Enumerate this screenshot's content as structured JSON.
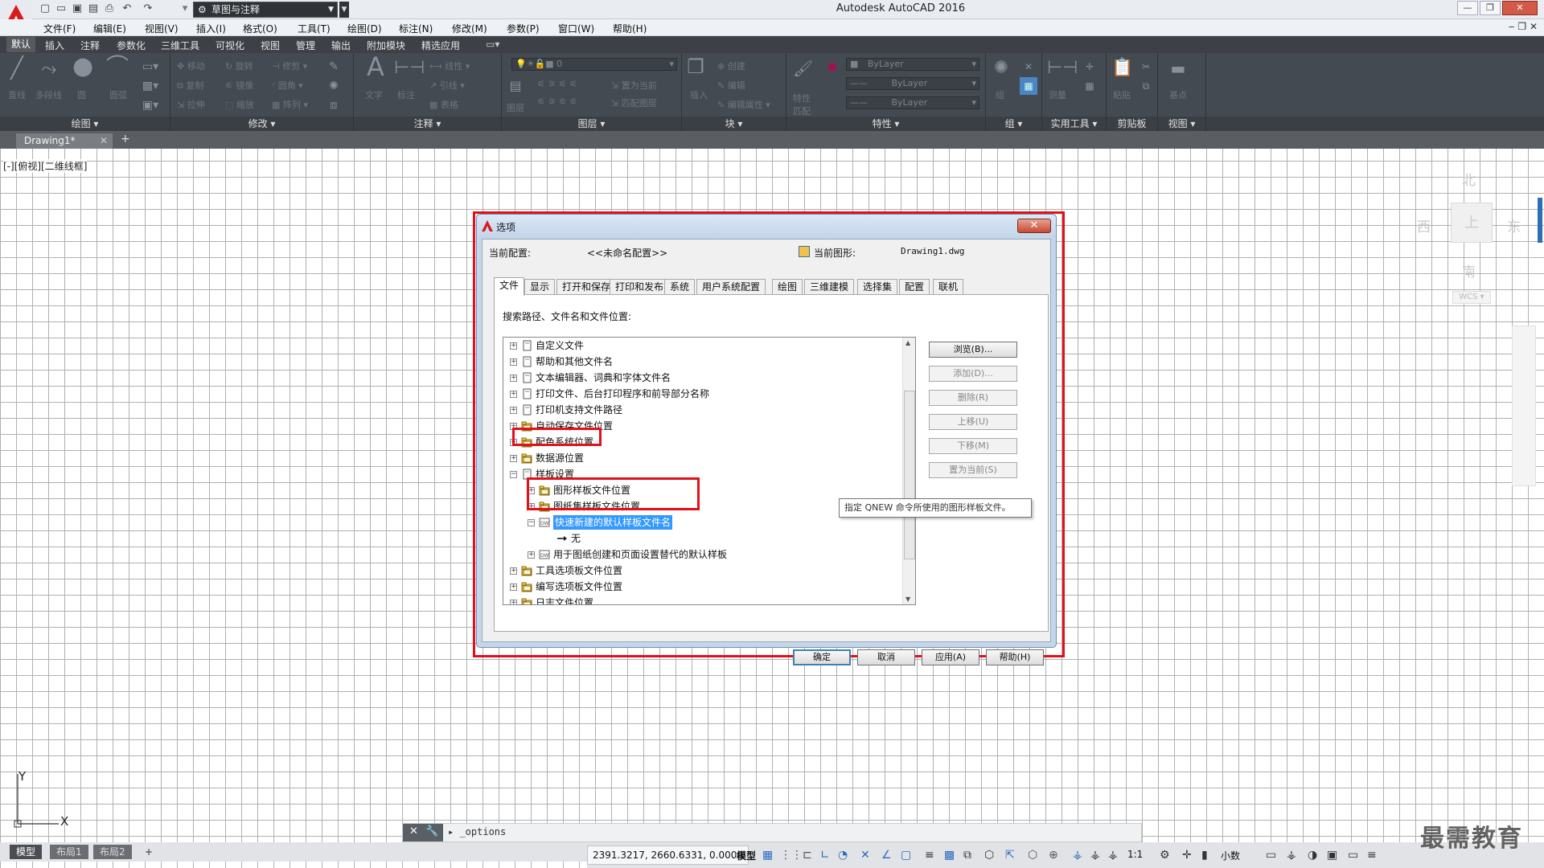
{
  "app": {
    "window_title": "Autodesk AutoCAD 2016",
    "workspace": "草图与注释"
  },
  "menubar": [
    "文件(F)",
    "编辑(E)",
    "视图(V)",
    "插入(I)",
    "格式(O)",
    "工具(T)",
    "绘图(D)",
    "标注(N)",
    "修改(M)",
    "参数(P)",
    "窗口(W)",
    "帮助(H)"
  ],
  "ribbon_tabs": [
    "默认",
    "插入",
    "注释",
    "参数化",
    "三维工具",
    "可视化",
    "视图",
    "管理",
    "输出",
    "附加模块",
    "精选应用"
  ],
  "ribbon": {
    "panels": [
      "绘图 ▾",
      "修改 ▾",
      "注释 ▾",
      "图层 ▾",
      "块 ▾",
      "特性 ▾",
      "组 ▾",
      "实用工具 ▾",
      "剪贴板",
      "视图 ▾"
    ],
    "draw_tools": [
      "直线",
      "多段线",
      "圆",
      "圆弧"
    ],
    "modify_tools": [
      "移动",
      "旋转",
      "修剪",
      "复制",
      "镜像",
      "圆角",
      "拉伸",
      "缩放",
      "阵列"
    ],
    "annotation_tools": [
      "文字",
      "标注",
      "线性",
      "引线",
      "表格"
    ],
    "layer_tools": [
      "图层特性",
      "置为当前",
      "匹配图层"
    ],
    "layer_combo": "0",
    "block_tools": [
      "插入",
      "创建",
      "编辑",
      "编辑属性"
    ],
    "props": {
      "color": "ByLayer",
      "linetype": "ByLayer",
      "lineweight": "ByLayer",
      "match": "特性匹配"
    },
    "utility": [
      "测量"
    ],
    "clipboard": [
      "粘贴"
    ],
    "view_tool": "基点"
  },
  "document_tabs": {
    "active": "Drawing1*",
    "add": "+"
  },
  "viewport_label": "[-][俯视][二维线框]",
  "viewcube": {
    "north": "北",
    "south": "南",
    "east": "东",
    "west": "西",
    "top": "上",
    "wcs": "WCS ▾"
  },
  "ucs": {
    "x": "X",
    "y": "Y"
  },
  "dialog": {
    "title": "选项",
    "current_profile_label": "当前配置:",
    "current_profile_value": "<<未命名配置>>",
    "current_drawing_label": "当前图形:",
    "current_drawing_value": "Drawing1.dwg",
    "tabs": [
      "文件",
      "显示",
      "打开和保存",
      "打印和发布",
      "系统",
      "用户系统配置",
      "绘图",
      "三维建模",
      "选择集",
      "配置",
      "联机"
    ],
    "section_label": "搜索路径、文件名和文件位置:",
    "tree": [
      {
        "label": "自定义文件",
        "level": 0,
        "exp": "+",
        "icon": "doc"
      },
      {
        "label": "帮助和其他文件名",
        "level": 0,
        "exp": "+",
        "icon": "doc"
      },
      {
        "label": "文本编辑器、词典和字体文件名",
        "level": 0,
        "exp": "+",
        "icon": "doc"
      },
      {
        "label": "打印文件、后台打印程序和前导部分名称",
        "level": 0,
        "exp": "+",
        "icon": "doc"
      },
      {
        "label": "打印机支持文件路径",
        "level": 0,
        "exp": "+",
        "icon": "doc"
      },
      {
        "label": "自动保存文件位置",
        "level": 0,
        "exp": "+",
        "icon": "folder"
      },
      {
        "label": "配色系统位置",
        "level": 0,
        "exp": "+",
        "icon": "folder"
      },
      {
        "label": "数据源位置",
        "level": 0,
        "exp": "+",
        "icon": "folder"
      },
      {
        "label": "样板设置",
        "level": 0,
        "exp": "−",
        "icon": "doc"
      },
      {
        "label": "图形样板文件位置",
        "level": 1,
        "exp": "+",
        "icon": "folder"
      },
      {
        "label": "图纸集样板文件位置",
        "level": 1,
        "exp": "+",
        "icon": "folder"
      },
      {
        "label": "快速新建的默认样板文件名",
        "level": 1,
        "exp": "−",
        "icon": "dwt",
        "selected": true
      },
      {
        "label": "无",
        "level": 2,
        "exp": "",
        "icon": "arrow"
      },
      {
        "label": "用于图纸创建和页面设置替代的默认样板",
        "level": 1,
        "exp": "+",
        "icon": "dwt"
      },
      {
        "label": "工具选项板文件位置",
        "level": 0,
        "exp": "+",
        "icon": "folder"
      },
      {
        "label": "编写选项板文件位置",
        "level": 0,
        "exp": "+",
        "icon": "folder"
      },
      {
        "label": "日志文件位置",
        "level": 0,
        "exp": "+",
        "icon": "folder"
      }
    ],
    "side_buttons": [
      {
        "label": "浏览(B)...",
        "enabled": true
      },
      {
        "label": "添加(D)...",
        "enabled": false
      },
      {
        "label": "删除(R)",
        "enabled": false
      },
      {
        "label": "上移(U)",
        "enabled": false
      },
      {
        "label": "下移(M)",
        "enabled": false
      },
      {
        "label": "置为当前(S)",
        "enabled": false
      }
    ],
    "tooltip": "指定 QNEW 命令所使用的图形样板文件。",
    "footer": {
      "ok": "确定",
      "cancel": "取消",
      "apply": "应用(A)",
      "help": "帮助(H)"
    }
  },
  "command_line": {
    "text": "_options"
  },
  "layout_tabs": [
    "模型",
    "布局1",
    "布局2",
    "+"
  ],
  "status": {
    "coords": "2391.3217, 2660.6331, 0.0000",
    "model": "模型",
    "scale": "1:1",
    "units": "小数"
  },
  "watermark": "最需教育"
}
